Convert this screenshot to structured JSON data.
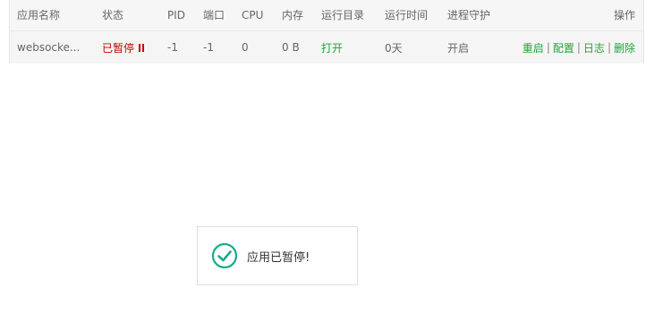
{
  "table": {
    "headers": {
      "name": "应用名称",
      "status": "状态",
      "pid": "PID",
      "port": "端口",
      "cpu": "CPU",
      "memory": "内存",
      "run_dir": "运行目录",
      "run_time": "运行时间",
      "guard": "进程守护",
      "ops": "操作"
    },
    "rows": [
      {
        "name": "websocke...",
        "status": "已暂停",
        "pid": "-1",
        "port": "-1",
        "cpu": "0",
        "memory": "0 B",
        "run_dir": "打开",
        "run_time": "0天",
        "guard": "开启",
        "ops": [
          "重启",
          "配置",
          "日志",
          "删除"
        ]
      }
    ]
  },
  "toast": {
    "message": "应用已暂停!"
  },
  "colors": {
    "accent_green": "#20a53a",
    "status_red": "#cc0000",
    "toast_check": "#1aab8a"
  }
}
